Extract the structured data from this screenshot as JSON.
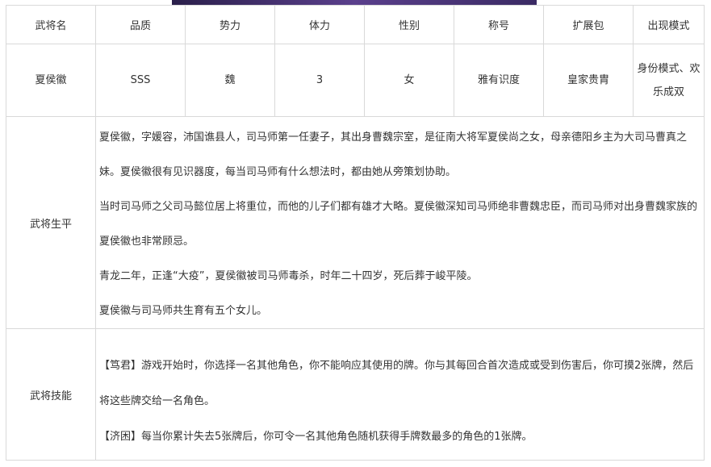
{
  "header": [
    "武将名",
    "品质",
    "势力",
    "体力",
    "性别",
    "称号",
    "扩展包",
    "出现模式"
  ],
  "row": [
    "夏侯徽",
    "SSS",
    "魏",
    "3",
    "女",
    "雅有识度",
    "皇家贵胄",
    "身份模式、欢乐成双"
  ],
  "biography": {
    "label": "武将生平",
    "paragraphs": [
      "夏侯徽，字媛容，沛国谯县人，司马师第一任妻子，其出身曹魏宗室，是征南大将军夏侯尚之女，母亲德阳乡主为大司马曹真之妹。夏侯徽很有见识器度，每当司马师有什么想法时，都由她从旁策划协助。",
      "当时司马师之父司马懿位居上将重位，而他的儿子们都有雄才大略。夏侯徽深知司马师绝非曹魏忠臣，而司马师对出身曹魏家族的夏侯徽也非常顾忌。",
      "青龙二年，正逢“大疫”，夏侯徽被司马师毒杀，时年二十四岁，死后葬于峻平陵。",
      "夏侯徽与司马师共生育有五个女儿。"
    ]
  },
  "skills": {
    "label": "武将技能",
    "paragraphs": [
      "【笃君】游戏开始时，你选择一名其他角色，你不能响应其使用的牌。你与其每回合首次造成或受到伤害后，你可摸2张牌，然后将这些牌交给一名角色。",
      "【济困】每当你累计失去5张牌后，你可令一名其他角色随机获得手牌数最多的角色的1张牌。"
    ]
  }
}
